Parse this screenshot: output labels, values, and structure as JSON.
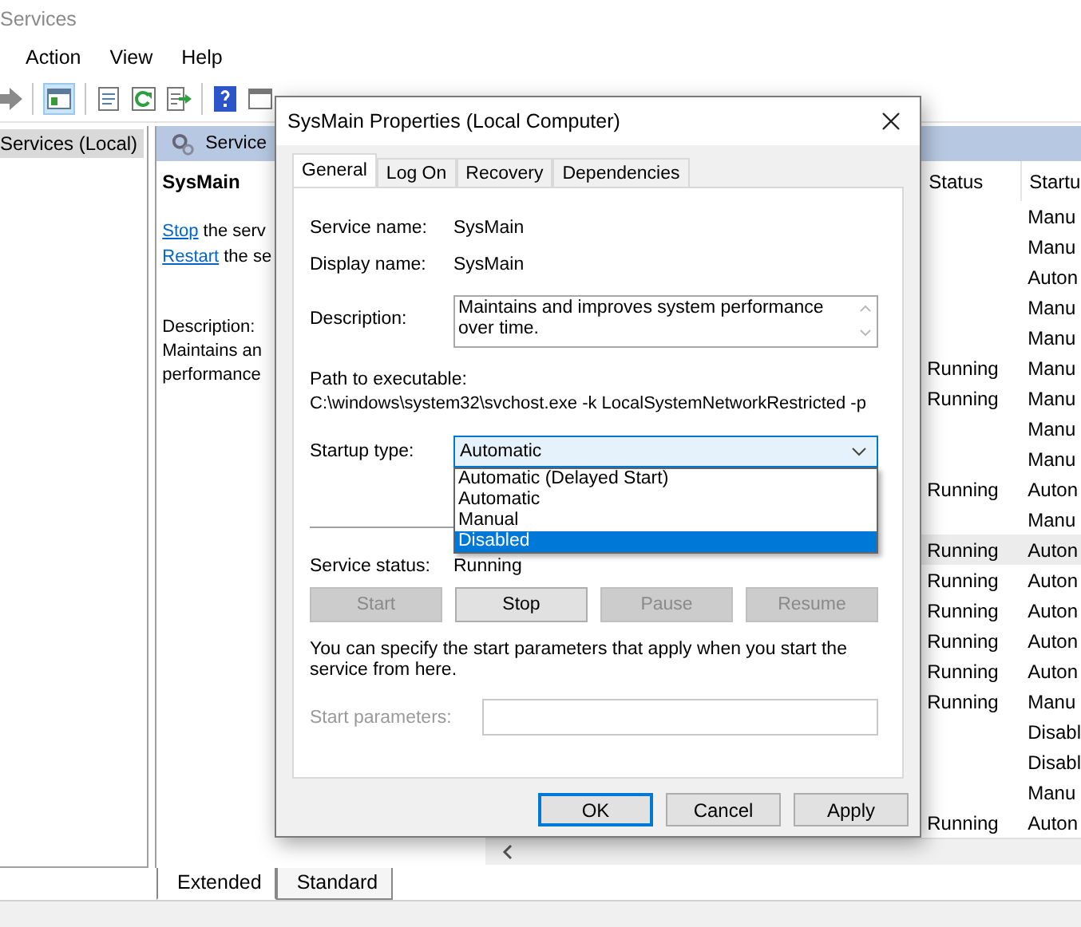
{
  "window": {
    "title": "Services"
  },
  "menu": [
    "Action",
    "View",
    "Help"
  ],
  "tree": {
    "items": [
      {
        "label": "Services (Local)",
        "selected": true
      }
    ]
  },
  "pane_header": {
    "title": "Service"
  },
  "details": {
    "name": "SysMain",
    "links": [
      {
        "link": "Stop",
        "rest": "the serv"
      },
      {
        "link": "Restart",
        "rest": "the se"
      }
    ],
    "description_label": "Description:",
    "description_lines": [
      "Maintains an",
      "performance"
    ]
  },
  "table": {
    "columns": [
      "Status",
      "Startu"
    ],
    "rows": [
      {
        "startup": "Manu",
        "selected": false
      },
      {
        "startup": "Manu",
        "selected": false
      },
      {
        "startup": "Auton",
        "selected": false
      },
      {
        "startup": "Manu",
        "selected": false
      },
      {
        "startup": "Manu",
        "selected": false
      },
      {
        "status": "Running",
        "startup": "Manu",
        "selected": false
      },
      {
        "status": "Running",
        "startup": "Manu",
        "selected": false
      },
      {
        "startup": "Manu",
        "selected": false
      },
      {
        "startup": "Manu",
        "selected": false
      },
      {
        "status": "Running",
        "startup": "Auton",
        "selected": false
      },
      {
        "startup": "Manu",
        "selected": false
      },
      {
        "status": "Running",
        "startup": "Auton",
        "selected": true
      },
      {
        "status": "Running",
        "startup": "Auton",
        "selected": false
      },
      {
        "status": "Running",
        "startup": "Auton",
        "selected": false
      },
      {
        "status": "Running",
        "startup": "Auton",
        "selected": false
      },
      {
        "status": "Running",
        "startup": "Auton",
        "selected": false
      },
      {
        "status": "Running",
        "startup": "Manu",
        "selected": false
      },
      {
        "startup": "Disabl",
        "selected": false
      },
      {
        "startup": "Disabl",
        "selected": false
      },
      {
        "startup": "Manu",
        "selected": false
      },
      {
        "status": "Running",
        "startup": "Auton",
        "selected": false
      }
    ]
  },
  "view_tabs": [
    {
      "label": "Extended",
      "selected": true
    },
    {
      "label": "Standard",
      "selected": false
    }
  ],
  "dialog": {
    "title": "SysMain Properties (Local Computer)",
    "tabs": [
      {
        "label": "General",
        "selected": true
      },
      {
        "label": "Log On",
        "selected": false
      },
      {
        "label": "Recovery",
        "selected": false
      },
      {
        "label": "Dependencies",
        "selected": false
      }
    ],
    "fields": [
      {
        "label": "Service name:",
        "value": "SysMain"
      },
      {
        "label": "Display name:",
        "value": "SysMain"
      }
    ],
    "description": {
      "label": "Description:",
      "value": "Maintains and improves system performance over time."
    },
    "path": {
      "label": "Path to executable:",
      "value": "C:\\windows\\system32\\svchost.exe -k LocalSystemNetworkRestricted -p"
    },
    "startup_type": {
      "label": "Startup type:",
      "value": "Automatic",
      "expanded": true,
      "options": [
        {
          "label": "Automatic (Delayed Start)",
          "highlighted": false
        },
        {
          "label": "Automatic",
          "highlighted": false
        },
        {
          "label": "Manual",
          "highlighted": false
        },
        {
          "label": "Disabled",
          "highlighted": true
        }
      ]
    },
    "service_status": {
      "label": "Service status:",
      "value": "Running"
    },
    "control_buttons": [
      {
        "label": "Start",
        "disabled": true
      },
      {
        "label": "Stop",
        "disabled": false
      },
      {
        "label": "Pause",
        "disabled": true
      },
      {
        "label": "Resume",
        "disabled": true
      }
    ],
    "hint": "You can specify the start parameters that apply when you start the service from here.",
    "start_parameters": {
      "label": "Start parameters:",
      "disabled": true
    },
    "buttons": [
      {
        "label": "OK",
        "default": true
      },
      {
        "label": "Cancel",
        "default": false
      },
      {
        "label": "Apply",
        "default": false
      }
    ]
  }
}
